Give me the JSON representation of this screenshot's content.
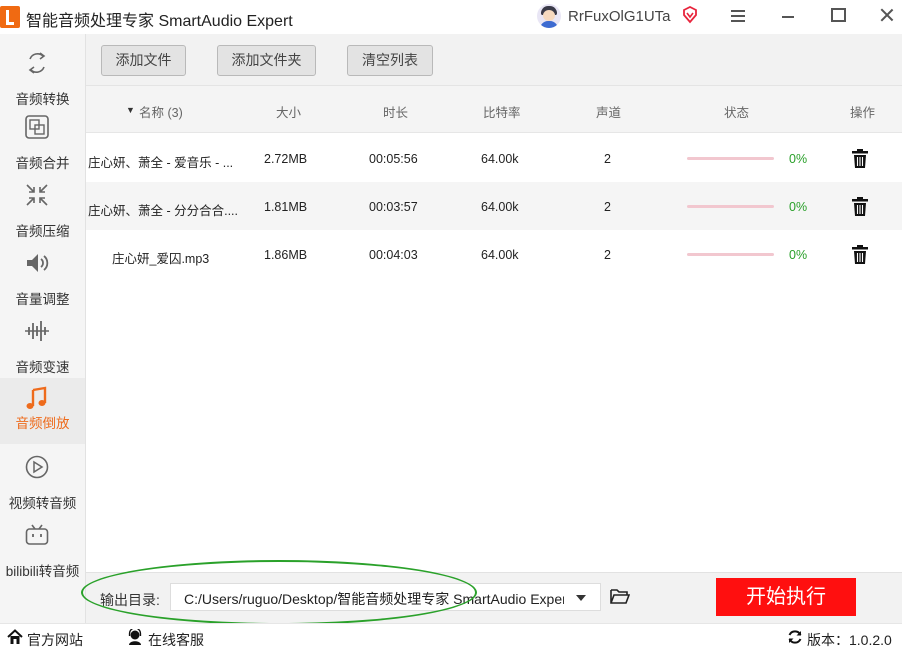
{
  "app": {
    "title": "智能音频处理专家 SmartAudio Expert"
  },
  "user": {
    "name": "RrFuxOlG1UTa"
  },
  "sidebar": {
    "items": [
      {
        "label": "音频转换",
        "icon": "convert-icon"
      },
      {
        "label": "音频合并",
        "icon": "merge-icon"
      },
      {
        "label": "音频压缩",
        "icon": "compress-icon"
      },
      {
        "label": "音量调整",
        "icon": "volume-icon"
      },
      {
        "label": "音频变速",
        "icon": "speed-icon"
      },
      {
        "label": "音频倒放",
        "icon": "music-note-icon",
        "active": true
      },
      {
        "label": "视频转音频",
        "icon": "play-circle-icon"
      },
      {
        "label": "bilibili转音频",
        "icon": "bilibili-icon"
      }
    ]
  },
  "toolbar": {
    "add_file": "添加文件",
    "add_folder": "添加文件夹",
    "clear_list": "清空列表"
  },
  "table": {
    "sort_arrow": "▼",
    "headers": {
      "name": "名称 (3)",
      "size": "大小",
      "duration": "时长",
      "bitrate": "比特率",
      "channels": "声道",
      "status": "状态",
      "action": "操作"
    },
    "rows": [
      {
        "name": "庄心妍、萧全 - 爱音乐 - ...",
        "size": "2.72MB",
        "duration": "00:05:56",
        "bitrate": "64.00k",
        "channels": "2",
        "progress_pct": 0,
        "status": "0%"
      },
      {
        "name": "庄心妍、萧全 - 分分合合....",
        "size": "1.81MB",
        "duration": "00:03:57",
        "bitrate": "64.00k",
        "channels": "2",
        "progress_pct": 0,
        "status": "0%"
      },
      {
        "name": "庄心妍_爱囚.mp3",
        "size": "1.86MB",
        "duration": "00:04:03",
        "bitrate": "64.00k",
        "channels": "2",
        "progress_pct": 0,
        "status": "0%"
      }
    ]
  },
  "output": {
    "label": "输出目录:",
    "path": "C:/Users/ruguo/Desktop/智能音频处理专家 SmartAudio Expert",
    "start_button": "开始执行"
  },
  "statusbar": {
    "website": "官方网站",
    "support": "在线客服",
    "version": "版本：1.0.2.0"
  },
  "colors": {
    "accent": "#ee6b1c",
    "start_button": "#ff0f0f",
    "status_text": "#2aa02a",
    "annotation": "#2aa12a"
  }
}
